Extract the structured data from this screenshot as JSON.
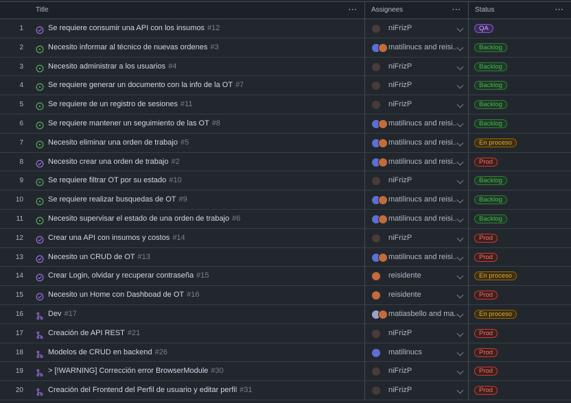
{
  "header": {
    "title_label": "Title",
    "assignees_label": "Assignees",
    "status_label": "Status",
    "menu_glyph": "···"
  },
  "status_styles": {
    "QA": {
      "fg": "#d2a8ff",
      "bg": "#3b2a5a",
      "border": "#8957e5"
    },
    "Backlog": {
      "fg": "#57ab5a",
      "bg": "#1b3a25",
      "border": "#347d39"
    },
    "En proceso": {
      "fg": "#daaa3f",
      "bg": "#3d2f12",
      "border": "#966600"
    },
    "Prod": {
      "fg": "#f47067",
      "bg": "#3d1f1d",
      "border": "#c93c37"
    }
  },
  "icon_colors": {
    "closed-issue": "#986ee2",
    "open-issue": "#57ab5a",
    "pull-request": "#986ee2"
  },
  "avatar_colors": {
    "niFrizP": "#4a3b3b",
    "matilinucs": "#5b6fd6",
    "reisidente": "#c46b3a",
    "matiasbello": "#9aa3c7"
  },
  "rows": [
    {
      "n": "1",
      "title": "Se requiere consumir una API con los insumos",
      "ref": "#12",
      "icon": "closed-issue",
      "avatars": [
        "niFrizP"
      ],
      "assignee": "niFrizP",
      "status": "QA"
    },
    {
      "n": "2",
      "title": "Necesito informar al técnico de nuevas ordenes",
      "ref": "#3",
      "icon": "open-issue",
      "avatars": [
        "matilinucs",
        "reisidente"
      ],
      "assignee": "matilinucs and reisi...",
      "status": "Backlog"
    },
    {
      "n": "3",
      "title": "Necesito administrar a los usuarios",
      "ref": "#4",
      "icon": "open-issue",
      "avatars": [
        "niFrizP"
      ],
      "assignee": "niFrizP",
      "status": "Backlog"
    },
    {
      "n": "4",
      "title": "Se requiere generar un documento con la info de la OT",
      "ref": "#7",
      "icon": "open-issue",
      "avatars": [
        "niFrizP"
      ],
      "assignee": "niFrizP",
      "status": "Backlog"
    },
    {
      "n": "5",
      "title": "Se requiere de un registro de sesiones",
      "ref": "#11",
      "icon": "open-issue",
      "avatars": [
        "niFrizP"
      ],
      "assignee": "niFrizP",
      "status": "Backlog"
    },
    {
      "n": "6",
      "title": "Se requiere mantener un seguimiento de las OT",
      "ref": "#8",
      "icon": "open-issue",
      "avatars": [
        "matilinucs",
        "reisidente"
      ],
      "assignee": "matilinucs and reisi...",
      "status": "Backlog"
    },
    {
      "n": "7",
      "title": "Necesito eliminar una orden de trabajo",
      "ref": "#5",
      "icon": "open-issue",
      "avatars": [
        "matilinucs",
        "reisidente"
      ],
      "assignee": "matilinucs and reisi...",
      "status": "En proceso"
    },
    {
      "n": "8",
      "title": "Necesito crear una orden de trabajo",
      "ref": "#2",
      "icon": "closed-issue",
      "avatars": [
        "matilinucs",
        "reisidente"
      ],
      "assignee": "matilinucs and reisi...",
      "status": "Prod"
    },
    {
      "n": "9",
      "title": "Se requiere filtrar OT por su estado",
      "ref": "#10",
      "icon": "open-issue",
      "avatars": [
        "niFrizP"
      ],
      "assignee": "niFrizP",
      "status": "Backlog"
    },
    {
      "n": "10",
      "title": "Se requiere realizar busquedas de OT",
      "ref": "#9",
      "icon": "open-issue",
      "avatars": [
        "matilinucs",
        "reisidente"
      ],
      "assignee": "matilinucs and reisi...",
      "status": "Backlog"
    },
    {
      "n": "11",
      "title": "Necesito supervisar el estado de una orden de trabajo",
      "ref": "#6",
      "icon": "open-issue",
      "avatars": [
        "matilinucs",
        "reisidente"
      ],
      "assignee": "matilinucs and reisi...",
      "status": "Backlog"
    },
    {
      "n": "12",
      "title": "Crear una API con insumos y costos",
      "ref": "#14",
      "icon": "closed-issue",
      "avatars": [
        "niFrizP"
      ],
      "assignee": "niFrizP",
      "status": "Prod"
    },
    {
      "n": "13",
      "title": "Necesito un CRUD de OT",
      "ref": "#13",
      "icon": "closed-issue",
      "avatars": [
        "matilinucs",
        "reisidente"
      ],
      "assignee": "matilinucs and reisi...",
      "status": "Prod"
    },
    {
      "n": "14",
      "title": "Crear Login, olvidar y recuperar contraseña",
      "ref": "#15",
      "icon": "closed-issue",
      "avatars": [
        "reisidente"
      ],
      "assignee": "reisidente",
      "status": "En proceso"
    },
    {
      "n": "15",
      "title": "Necesito un Home con Dashboad de OT",
      "ref": "#16",
      "icon": "closed-issue",
      "avatars": [
        "reisidente"
      ],
      "assignee": "reisidente",
      "status": "Prod"
    },
    {
      "n": "16",
      "title": "Dev",
      "ref": "#17",
      "icon": "pull-request",
      "avatars": [
        "matiasbello",
        "reisidente"
      ],
      "assignee": "matiasbello and ma...",
      "status": "En proceso"
    },
    {
      "n": "17",
      "title": "Creación de API REST",
      "ref": "#21",
      "icon": "pull-request",
      "avatars": [
        "niFrizP"
      ],
      "assignee": "niFrizP",
      "status": "Prod"
    },
    {
      "n": "18",
      "title": "Modelos de CRUD en backend",
      "ref": "#26",
      "icon": "pull-request",
      "avatars": [
        "matilinucs"
      ],
      "assignee": "matilinucs",
      "status": "Prod"
    },
    {
      "n": "19",
      "title": "> [!WARNING] Corrección error BrowserModule",
      "ref": "#30",
      "icon": "pull-request",
      "avatars": [
        "niFrizP"
      ],
      "assignee": "niFrizP",
      "status": "Prod"
    },
    {
      "n": "20",
      "title": "Creación del Frontend del Perfil de usuario y editar perfil",
      "ref": "#31",
      "icon": "pull-request",
      "avatars": [
        "niFrizP"
      ],
      "assignee": "niFrizP",
      "status": "Prod"
    }
  ]
}
